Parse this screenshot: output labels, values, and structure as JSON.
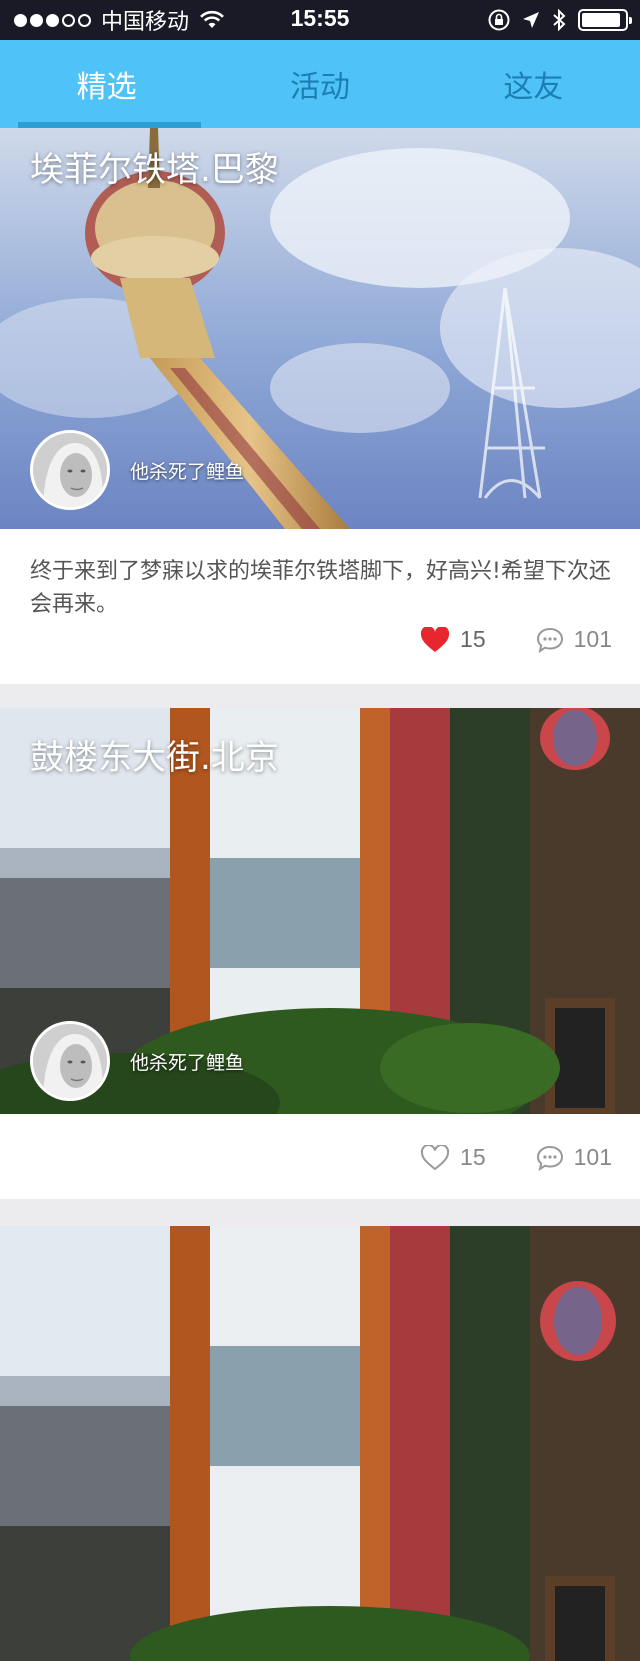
{
  "status_bar": {
    "carrier": "中国移动",
    "time": "15:55",
    "signal_dots_filled": 3,
    "signal_dots_total": 5,
    "battery_level": 0.9
  },
  "tabs": [
    {
      "label": "精选",
      "active": true
    },
    {
      "label": "活动",
      "active": false
    },
    {
      "label": "这友",
      "active": false
    }
  ],
  "posts": [
    {
      "place": "埃菲尔铁塔.巴黎",
      "author": "他杀死了鲤鱼",
      "caption": "终于来到了梦寐以求的埃菲尔铁塔脚下，好高兴!希望下次还会再来。",
      "likes": "15",
      "comments": "101",
      "liked": true
    },
    {
      "place": "鼓楼东大街.北京",
      "author": "他杀死了鲤鱼",
      "caption": "",
      "likes": "15",
      "comments": "101",
      "liked": false
    },
    {
      "place": "",
      "author": "",
      "caption": "",
      "likes": "",
      "comments": "",
      "liked": false
    }
  ],
  "icons": {
    "wifi": "wifi-icon",
    "lock": "orientation-lock-icon",
    "location": "location-arrow-icon",
    "bluetooth": "bluetooth-icon",
    "heart": "heart-icon",
    "comment": "comment-bubble-icon"
  },
  "colors": {
    "tab_bar": "#4fc3f7",
    "tab_active_text": "#ffffff",
    "tab_inactive_text": "#1c7fb3",
    "like_red": "#e8262d",
    "status_bar": "#1a1a26"
  }
}
